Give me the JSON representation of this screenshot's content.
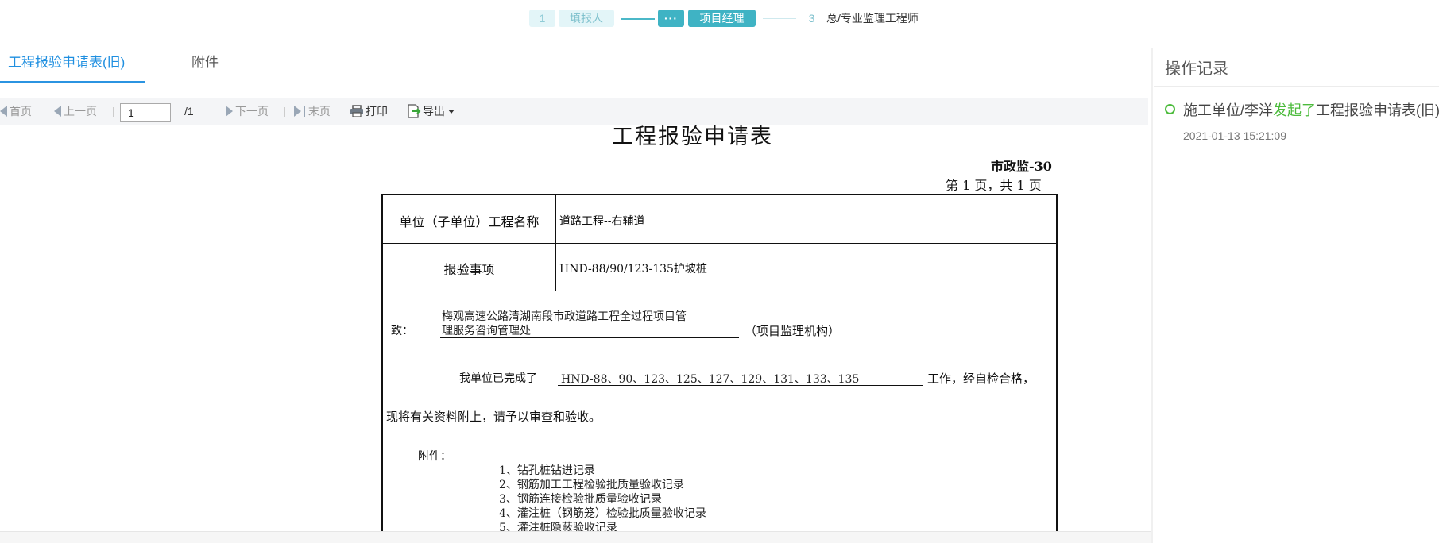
{
  "stepper": {
    "step1_num": "1",
    "step1_label": "填报人",
    "step2_num": "···",
    "step2_label": "项目经理",
    "step3_num": "3",
    "step3_label": "总/专业监理工程师"
  },
  "tabs": {
    "main": "工程报验申请表(旧)",
    "attachment": "附件"
  },
  "toolbar": {
    "first": "首页",
    "prev": "上一页",
    "page_value": "1",
    "page_total": "/1",
    "next": "下一页",
    "last": "末页",
    "print": "打印",
    "export": "导出"
  },
  "document": {
    "title": "工程报验申请表",
    "code": "市政监-30",
    "page_info": "第 1 页，共 1 页",
    "unit_label": "单位（子单位）工程名称",
    "unit_value": "道路工程--右辅道",
    "item_label": "报验事项",
    "item_value": "HND-88/90/123-135护坡桩",
    "to_label": "致：",
    "to_value_line1": "梅观高速公路清湖南段市政道路工程全过程项目管",
    "to_value_line2": "理服务咨询管理处",
    "to_suffix": "（项目监理机构）",
    "completed_prefix": "我单位已完成了",
    "completed_value": "HND-88、90、123、125、127、129、131、133、135",
    "completed_suffix": "工作，经自检合格，",
    "request_text": "现将有关资料附上，请予以审查和验收。",
    "attachments_label": "附件：",
    "attachments": [
      "1、钻孔桩钻进记录",
      "2、钢筋加工工程检验批质量验收记录",
      "3、钢筋连接检验批质量验收记录",
      "4、灌注桩（钢筋笼）检验批质量验收记录",
      "5、灌注桩隐蔽验收记录"
    ]
  },
  "panel": {
    "title": "操作记录",
    "log_actor": "施工单位/李洋",
    "log_action": "发起了",
    "log_object": "工程报验申请表(旧)",
    "log_time": "2021-01-13 15:21:09"
  },
  "colors": {
    "accent": "#3fb3c4",
    "tab_active": "#1f8fe0",
    "log_green": "#4cbb3c"
  }
}
